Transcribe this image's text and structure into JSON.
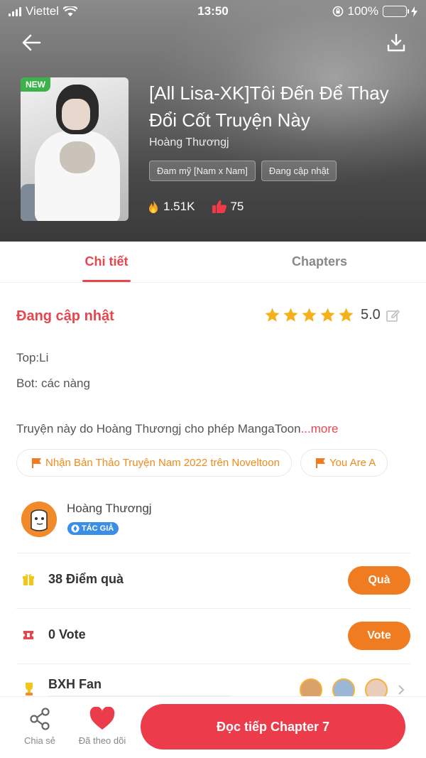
{
  "status_bar": {
    "carrier": "Viettel",
    "time": "13:50",
    "battery": "100%"
  },
  "book": {
    "badge": "NEW",
    "title": "[All Lisa-XK]Tôi Đến Để Thay Đổi Cốt Truyện Này",
    "author": "Hoàng Thươngj",
    "tags": [
      "Đam mỹ [Nam x Nam]",
      "Đang cập nhật"
    ],
    "views": "1.51K",
    "likes": "75"
  },
  "tabs": [
    {
      "label": "Chi tiết",
      "active": true
    },
    {
      "label": "Chapters",
      "active": false
    }
  ],
  "detail": {
    "status": "Đang cập nhật",
    "rating": "5.0",
    "stars": 5,
    "description_lines": [
      "Top:Li",
      "Bot: các nàng"
    ],
    "description_more": "Truyện này do Hoàng Thươngj cho phép MangaToon",
    "more_link": "...more",
    "events": [
      "Nhận Bản Thảo Truyện Nam 2022 trên Noveltoon",
      "You Are A"
    ]
  },
  "author_card": {
    "name": "Hoàng Thươngj",
    "badge": "TÁC GIẢ"
  },
  "gift_row": {
    "label": "38 Điểm quà",
    "button": "Quà"
  },
  "vote_row": {
    "label": "0 Vote",
    "button": "Vote"
  },
  "fan_row": {
    "label": "BXH Fan"
  },
  "bottom_bar": {
    "share": "Chia sẻ",
    "follow": "Đã theo dõi",
    "read": "Đọc tiếp Chapter 7"
  },
  "colors": {
    "accent": "#e8464d",
    "orange": "#f07c21",
    "read_button": "#ec3b4a",
    "new_badge": "#3cb34a"
  }
}
